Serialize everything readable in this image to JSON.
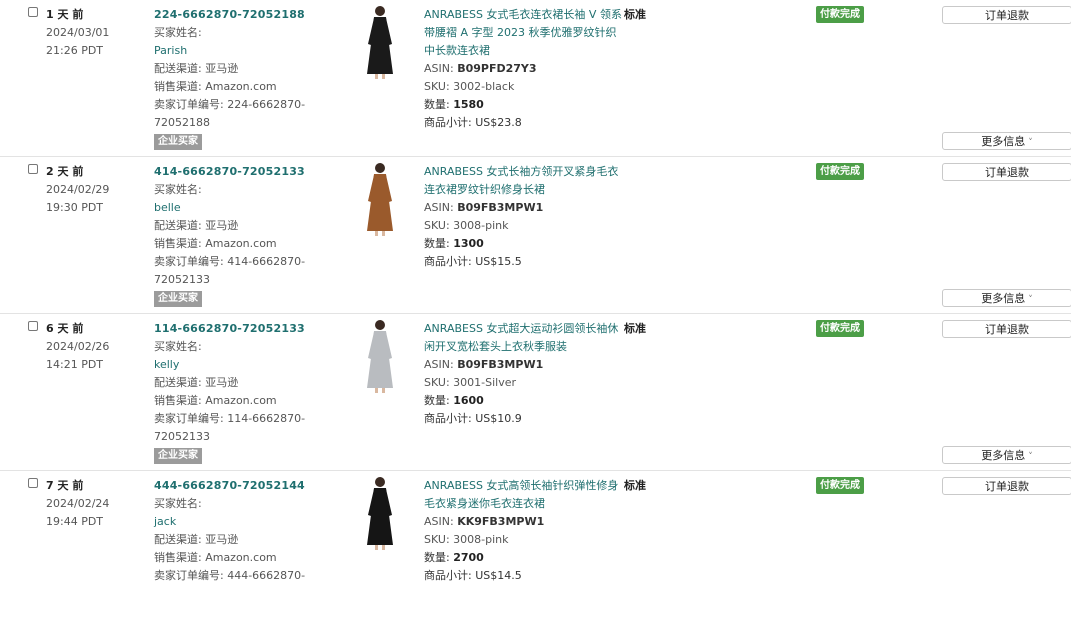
{
  "orders": [
    {
      "age": "1 天 前",
      "date": "2024/03/01",
      "time": "21:26 PDT",
      "order_id": "224-6662870-72052188",
      "buyer_label": "买家姓名:",
      "buyer": "Parish",
      "fulfillment": "配送渠道: 亚马逊",
      "channel": "销售渠道: Amazon.com",
      "seller_order_line1": "卖家订单编号: 224-6662870-",
      "seller_order_line2": "72052188",
      "b2b": "企业买家",
      "title_line1": "ANRABESS 女式毛衣连衣裙长袖 V 领系",
      "title_line2": "带腰褶 A 字型 2023 秋季优雅罗纹针织",
      "title_line3": "中长款连衣裙",
      "standard": "标准",
      "asin_label": "ASIN:",
      "asin": "B09PFD27Y3",
      "sku": "SKU: 3002-black",
      "qty_label": "数量:",
      "qty": "1580",
      "subtotal": "商品小计: US$23.8",
      "status": "付款完成",
      "refund": "订单退款",
      "more": "更多信息",
      "product_color": "#1a1a1a"
    },
    {
      "age": "2 天 前",
      "date": "2024/02/29",
      "time": "19:30 PDT",
      "order_id": "414-6662870-72052133",
      "buyer_label": "买家姓名:",
      "buyer": "belle",
      "fulfillment": "配送渠道: 亚马逊",
      "channel": "销售渠道: Amazon.com",
      "seller_order_line1": "卖家订单编号: 414-6662870-",
      "seller_order_line2": "72052133",
      "b2b": "企业买家",
      "title_line1": "ANRABESS 女式长袖方领开叉紧身毛衣",
      "title_line2": "连衣裙罗纹针织修身长裙",
      "title_line3": "",
      "standard": "",
      "asin_label": "ASIN:",
      "asin": "B09FB3MPW1",
      "sku": "SKU: 3008-pink",
      "qty_label": "数量:",
      "qty": "1300",
      "subtotal": "商品小计: US$15.5",
      "status": "付款完成",
      "refund": "订单退款",
      "more": "更多信息",
      "product_color": "#9a5a2c"
    },
    {
      "age": "6 天 前",
      "date": "2024/02/26",
      "time": "14:21 PDT",
      "order_id": "114-6662870-72052133",
      "buyer_label": "买家姓名:",
      "buyer": "kelly",
      "fulfillment": "配送渠道: 亚马逊",
      "channel": "销售渠道: Amazon.com",
      "seller_order_line1": "卖家订单编号: 114-6662870-",
      "seller_order_line2": "72052133",
      "b2b": "企业买家",
      "title_line1": "ANRABESS 女式超大运动衫圆领长袖休",
      "title_line2": "闲开叉宽松套头上衣秋季服装",
      "title_line3": "",
      "standard": "标准",
      "asin_label": "ASIN:",
      "asin": "B09FB3MPW1",
      "sku": "SKU: 3001-Silver",
      "qty_label": "数量:",
      "qty": "1600",
      "subtotal": "商品小计: US$10.9",
      "status": "付款完成",
      "refund": "订单退款",
      "more": "更多信息",
      "product_color": "#b9bcc0"
    },
    {
      "age": "7 天 前",
      "date": "2024/02/24",
      "time": "19:44 PDT",
      "order_id": "444-6662870-72052144",
      "buyer_label": "买家姓名:",
      "buyer": "jack",
      "fulfillment": "配送渠道: 亚马逊",
      "channel": "销售渠道: Amazon.com",
      "seller_order_line1": "卖家订单编号: 444-6662870-",
      "seller_order_line2": "",
      "b2b": "",
      "title_line1": "ANRABESS 女式高领长袖针织弹性修身",
      "title_line2": "毛衣紧身迷你毛衣连衣裙",
      "title_line3": "",
      "standard": "标准",
      "asin_label": "ASIN:",
      "asin": "KK9FB3MPW1",
      "sku": "SKU: 3008-pink",
      "qty_label": "数量:",
      "qty": "2700",
      "subtotal": "商品小计: US$14.5",
      "status": "付款完成",
      "refund": "订单退款",
      "more": "",
      "product_color": "#151515"
    }
  ]
}
